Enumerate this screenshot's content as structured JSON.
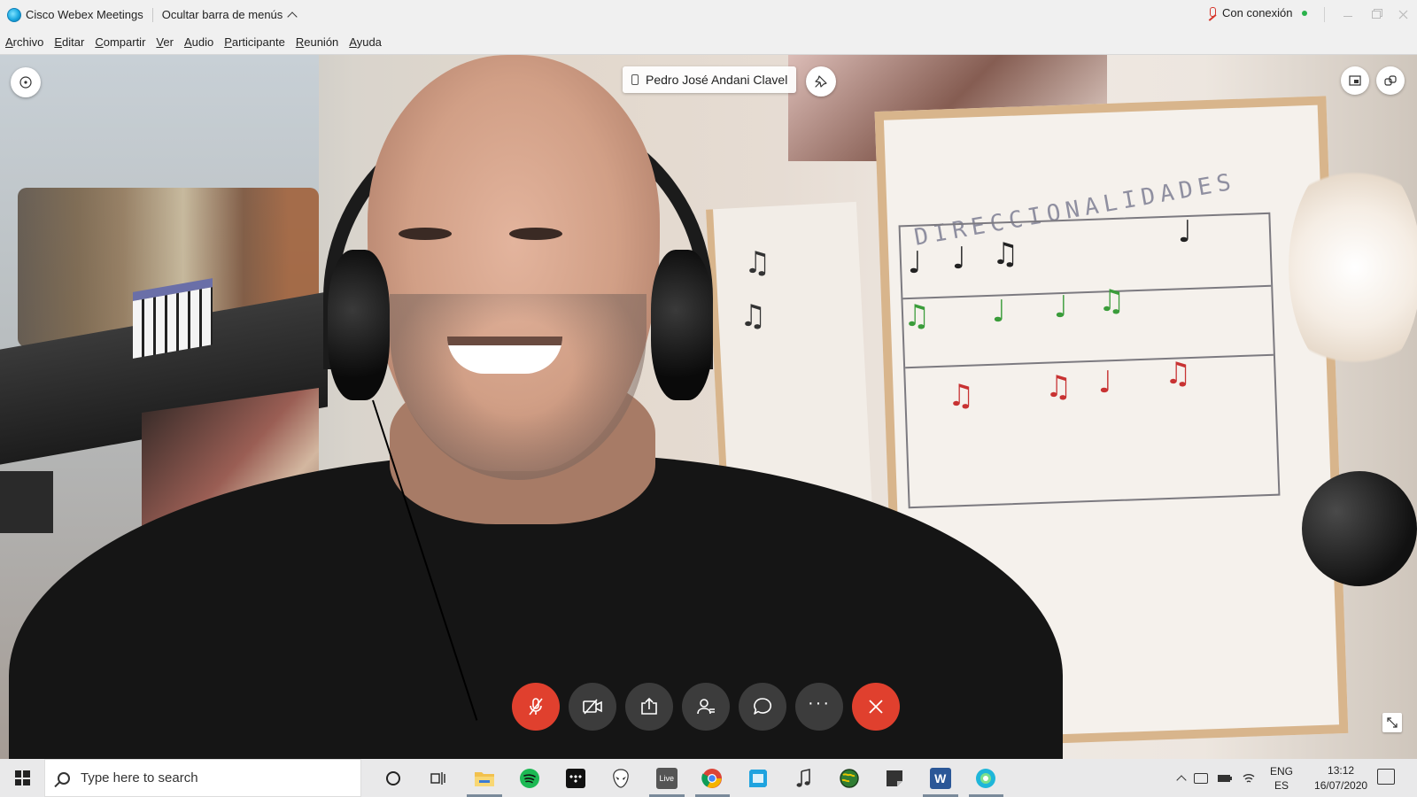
{
  "window": {
    "app_title": "Cisco Webex Meetings",
    "hide_menu_label": "Ocultar barra de menús",
    "connection_status": "Con conexión"
  },
  "menu": {
    "items": [
      "Archivo",
      "Editar",
      "Compartir",
      "Ver",
      "Audio",
      "Participante",
      "Reunión",
      "Ayuda"
    ]
  },
  "video": {
    "participant_name": "Pedro José Andani Clavel",
    "board_title": "DIRECCIONALIDADES"
  },
  "controls": [
    {
      "name": "mute-microphone-button",
      "icon": "microphone-off-icon",
      "color": "#e0402e"
    },
    {
      "name": "stop-video-button",
      "icon": "video-off-icon",
      "color": "#3c3c3c"
    },
    {
      "name": "share-button",
      "icon": "share-icon",
      "color": "#3c3c3c"
    },
    {
      "name": "participants-button",
      "icon": "participants-icon",
      "color": "#3c3c3c"
    },
    {
      "name": "chat-button",
      "icon": "chat-bubble-icon",
      "color": "#3c3c3c"
    },
    {
      "name": "more-options-button",
      "icon": "more-icon",
      "color": "#3c3c3c"
    },
    {
      "name": "leave-meeting-button",
      "icon": "close-icon",
      "color": "#e0402e"
    }
  ],
  "taskbar": {
    "search_placeholder": "Type here to search",
    "apps": [
      {
        "name": "cortana",
        "icon": "cortana-icon"
      },
      {
        "name": "task-view",
        "icon": "task-view-icon"
      },
      {
        "name": "file-explorer",
        "icon": "folder-icon",
        "active": true
      },
      {
        "name": "spotify",
        "icon": "spotify-icon"
      },
      {
        "name": "tidal",
        "icon": "tidal-icon"
      },
      {
        "name": "alien",
        "icon": "alien-icon"
      },
      {
        "name": "live",
        "icon": "live-icon",
        "label": "Live",
        "active": true
      },
      {
        "name": "chrome",
        "icon": "chrome-icon",
        "active": true
      },
      {
        "name": "app-blue",
        "icon": "square-app-icon"
      },
      {
        "name": "music",
        "icon": "music-note-icon"
      },
      {
        "name": "globe",
        "icon": "globe-icon"
      },
      {
        "name": "notes",
        "icon": "notes-icon"
      },
      {
        "name": "word",
        "icon": "word-icon",
        "label": "W",
        "active": true
      },
      {
        "name": "webex",
        "icon": "webex-icon",
        "active": true
      }
    ],
    "language": {
      "line1": "ENG",
      "line2": "ES"
    },
    "clock": {
      "time": "13:12",
      "date": "16/07/2020"
    }
  }
}
